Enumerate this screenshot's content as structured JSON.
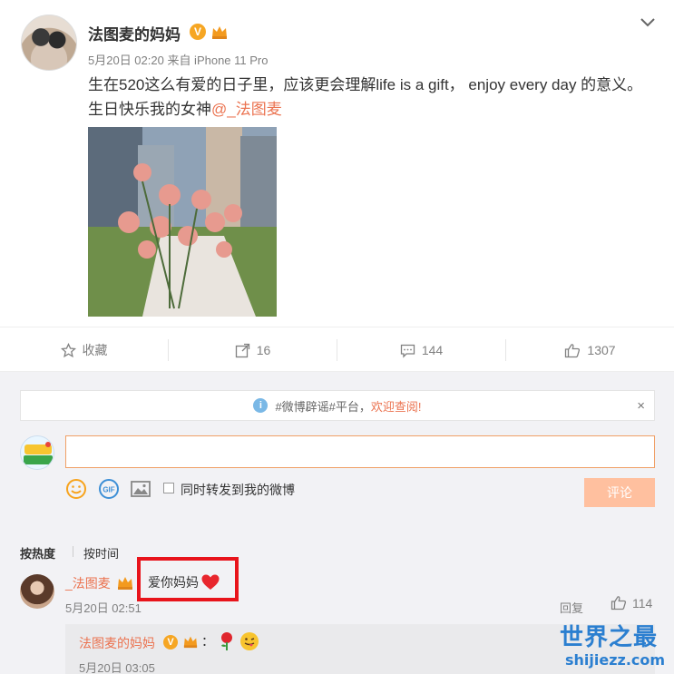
{
  "post": {
    "username": "法图麦的妈妈",
    "verified_mark": "V",
    "meta": "5月20日 02:20 来自 iPhone 11 Pro",
    "text": "生在520这么有爱的日子里，应该更会理解life is a gift，  enjoy every day 的意义。生日快乐我的女神",
    "mention": "@_法图麦",
    "photo_icon": "rose-bouquet-photo"
  },
  "actions": {
    "favorite": "收藏",
    "repost": "16",
    "comment": "144",
    "like": "1307"
  },
  "notice": {
    "icon": "i",
    "text": "#微博辟谣#平台，",
    "highlight": "欢迎查阅!",
    "close": "×"
  },
  "composer": {
    "input_value": "",
    "repost_label": "同时转发到我的微博",
    "submit_label": "评论"
  },
  "sort": {
    "hot": "按热度",
    "time": "按时间"
  },
  "comment": {
    "user": "_法图麦",
    "text": "爱你妈妈",
    "time": "5月20日 02:51",
    "reply": "回复",
    "likes": "114"
  },
  "reply": {
    "user": "法图麦的妈妈",
    "verified_mark": "V",
    "colon": "：",
    "time": "5月20日 03:05"
  },
  "watermark": {
    "line1": "世界之最",
    "line2": "shijiezz.com"
  },
  "colors": {
    "accent": "#eb7350",
    "highlight_box": "#e8141b",
    "watermark": "#2b7fd0"
  }
}
